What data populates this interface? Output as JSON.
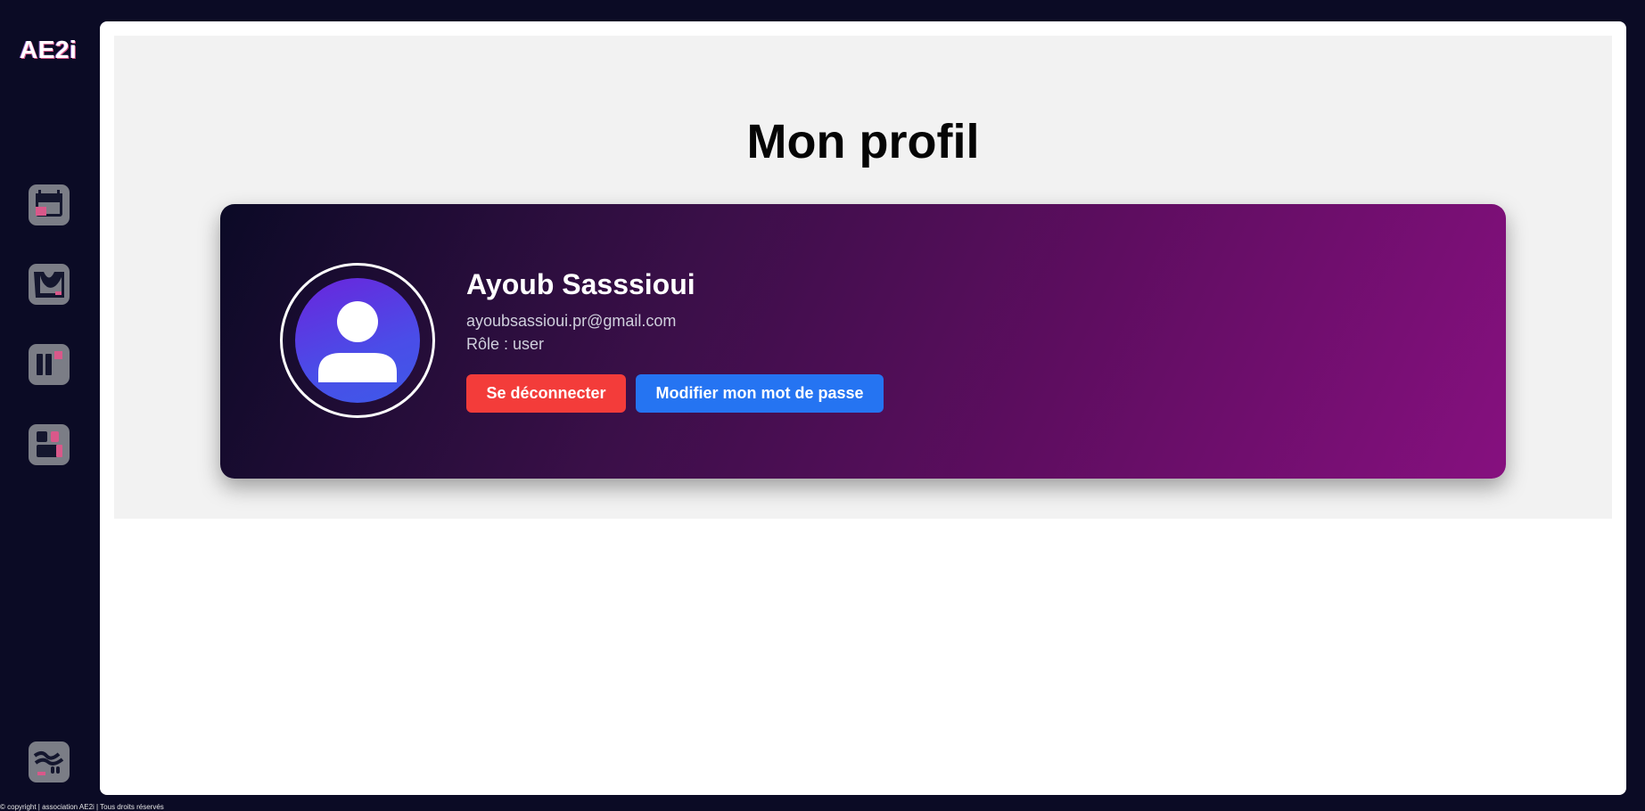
{
  "sidebar": {
    "logo": "AE2i",
    "items": [
      {
        "icon": "calendar-icon"
      },
      {
        "icon": "apparel-icon"
      },
      {
        "icon": "dashboard-icon"
      },
      {
        "icon": "widgets-icon"
      },
      {
        "icon": "settings-icon"
      }
    ]
  },
  "profile": {
    "title": "Mon profil",
    "name": "Ayoub Sasssioui",
    "email": "ayoubsassioui.pr@gmail.com",
    "role": "Rôle : user",
    "logout_label": "Se déconnecter",
    "change_password_label": "Modifier mon mot de passe"
  },
  "footer": {
    "text": "© copyright | association AE2i | Tous droits réservés"
  },
  "colors": {
    "background": "#0b0b25",
    "logout": "#f33c3a",
    "change_password": "#2574f2",
    "accent_pink": "#d9588a"
  }
}
